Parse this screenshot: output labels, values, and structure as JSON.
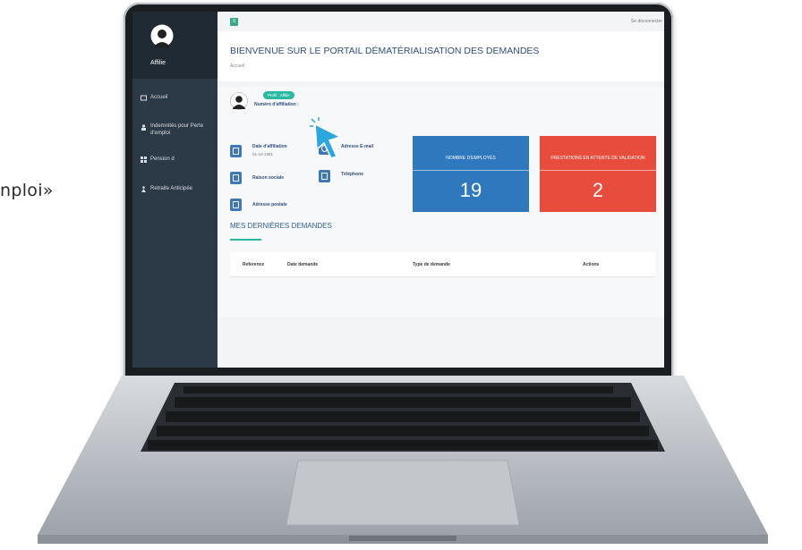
{
  "caption": {
    "partial_text": "nploi»"
  },
  "app": {
    "sidebar": {
      "user_name": "Affilie",
      "items": [
        {
          "label": "Accueil",
          "icon": "home-icon"
        },
        {
          "label": "Indemnités pour Perte d'emploi",
          "icon": "user-icon"
        },
        {
          "label": "Pension d",
          "icon": "grid-icon"
        },
        {
          "label": "Retraite Anticipée",
          "icon": "person-icon"
        }
      ]
    },
    "topbar": {
      "menu_icon": "≡",
      "logout_label": "Se déconnecter"
    },
    "header": {
      "title": "BIENVENUE SUR LE PORTAIL DÉMATÉRIALISATION DES DEMANDES",
      "breadcrumb": "Accueil"
    },
    "profile": {
      "badge": "Profil : Affilie",
      "affiliation_label": "Numéro d'affiliation :",
      "fields": {
        "date_affiliation": {
          "label": "Date d'affiliation",
          "value": "01-10-1991"
        },
        "email": {
          "label": "Adresse E-mail"
        },
        "raison_sociale": {
          "label": "Raison sociale"
        },
        "telephone": {
          "label": "Téléphone"
        },
        "adresse_postale": {
          "label": "Adresse postale"
        }
      }
    },
    "stats": [
      {
        "title": "NOMBRE D'EMPLOYÉS",
        "value": "19",
        "color": "#2f78bd"
      },
      {
        "title": "PRESTATIONS EN ATTENTE DE VALIDATION",
        "value": "2",
        "color": "#e84c3d"
      }
    ],
    "recent": {
      "title": "MES DERNIÈRES DEMANDES",
      "columns": [
        "Reference",
        "Date demande",
        "Type de demande",
        "Actions"
      ]
    }
  },
  "colors": {
    "sidebar": "#2c3a47",
    "accent_green": "#29b9a0",
    "title_blue": "#2f4f7b",
    "stat_blue": "#2f78bd",
    "stat_red": "#e84c3d",
    "cursor": "#2aa7de"
  }
}
